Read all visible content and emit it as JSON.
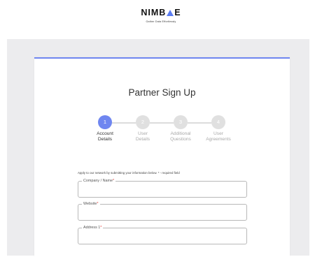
{
  "brand": {
    "logo_left": "NIMB",
    "logo_right": "E",
    "tagline": "Gather Data Effortlessly",
    "accent_color": "#6f86f0"
  },
  "page": {
    "title": "Partner Sign Up"
  },
  "stepper": {
    "steps": [
      {
        "number": "1",
        "line1": "Account",
        "line2": "Details",
        "active": true
      },
      {
        "number": "2",
        "line1": "User",
        "line2": "Details",
        "active": false
      },
      {
        "number": "3",
        "line1": "Additional",
        "line2": "Questions",
        "active": false
      },
      {
        "number": "4",
        "line1": "User",
        "line2": "Agreements",
        "active": false
      }
    ]
  },
  "form": {
    "intro": "Apply to our network by submitting your information below. * - required field",
    "required_marker": "*",
    "fields": [
      {
        "label": "Company / Name",
        "value": ""
      },
      {
        "label": "Website",
        "value": ""
      },
      {
        "label": "Address 1",
        "value": ""
      }
    ]
  }
}
